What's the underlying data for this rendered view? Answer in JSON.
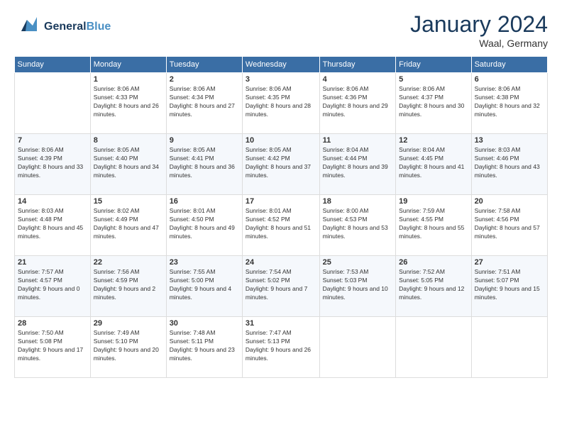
{
  "header": {
    "logo_general": "General",
    "logo_blue": "Blue",
    "month": "January 2024",
    "location": "Waal, Germany"
  },
  "days_of_week": [
    "Sunday",
    "Monday",
    "Tuesday",
    "Wednesday",
    "Thursday",
    "Friday",
    "Saturday"
  ],
  "weeks": [
    [
      {
        "day": "",
        "sunrise": "",
        "sunset": "",
        "daylight": ""
      },
      {
        "day": "1",
        "sunrise": "Sunrise: 8:06 AM",
        "sunset": "Sunset: 4:33 PM",
        "daylight": "Daylight: 8 hours and 26 minutes."
      },
      {
        "day": "2",
        "sunrise": "Sunrise: 8:06 AM",
        "sunset": "Sunset: 4:34 PM",
        "daylight": "Daylight: 8 hours and 27 minutes."
      },
      {
        "day": "3",
        "sunrise": "Sunrise: 8:06 AM",
        "sunset": "Sunset: 4:35 PM",
        "daylight": "Daylight: 8 hours and 28 minutes."
      },
      {
        "day": "4",
        "sunrise": "Sunrise: 8:06 AM",
        "sunset": "Sunset: 4:36 PM",
        "daylight": "Daylight: 8 hours and 29 minutes."
      },
      {
        "day": "5",
        "sunrise": "Sunrise: 8:06 AM",
        "sunset": "Sunset: 4:37 PM",
        "daylight": "Daylight: 8 hours and 30 minutes."
      },
      {
        "day": "6",
        "sunrise": "Sunrise: 8:06 AM",
        "sunset": "Sunset: 4:38 PM",
        "daylight": "Daylight: 8 hours and 32 minutes."
      }
    ],
    [
      {
        "day": "7",
        "sunrise": "Sunrise: 8:06 AM",
        "sunset": "Sunset: 4:39 PM",
        "daylight": "Daylight: 8 hours and 33 minutes."
      },
      {
        "day": "8",
        "sunrise": "Sunrise: 8:05 AM",
        "sunset": "Sunset: 4:40 PM",
        "daylight": "Daylight: 8 hours and 34 minutes."
      },
      {
        "day": "9",
        "sunrise": "Sunrise: 8:05 AM",
        "sunset": "Sunset: 4:41 PM",
        "daylight": "Daylight: 8 hours and 36 minutes."
      },
      {
        "day": "10",
        "sunrise": "Sunrise: 8:05 AM",
        "sunset": "Sunset: 4:42 PM",
        "daylight": "Daylight: 8 hours and 37 minutes."
      },
      {
        "day": "11",
        "sunrise": "Sunrise: 8:04 AM",
        "sunset": "Sunset: 4:44 PM",
        "daylight": "Daylight: 8 hours and 39 minutes."
      },
      {
        "day": "12",
        "sunrise": "Sunrise: 8:04 AM",
        "sunset": "Sunset: 4:45 PM",
        "daylight": "Daylight: 8 hours and 41 minutes."
      },
      {
        "day": "13",
        "sunrise": "Sunrise: 8:03 AM",
        "sunset": "Sunset: 4:46 PM",
        "daylight": "Daylight: 8 hours and 43 minutes."
      }
    ],
    [
      {
        "day": "14",
        "sunrise": "Sunrise: 8:03 AM",
        "sunset": "Sunset: 4:48 PM",
        "daylight": "Daylight: 8 hours and 45 minutes."
      },
      {
        "day": "15",
        "sunrise": "Sunrise: 8:02 AM",
        "sunset": "Sunset: 4:49 PM",
        "daylight": "Daylight: 8 hours and 47 minutes."
      },
      {
        "day": "16",
        "sunrise": "Sunrise: 8:01 AM",
        "sunset": "Sunset: 4:50 PM",
        "daylight": "Daylight: 8 hours and 49 minutes."
      },
      {
        "day": "17",
        "sunrise": "Sunrise: 8:01 AM",
        "sunset": "Sunset: 4:52 PM",
        "daylight": "Daylight: 8 hours and 51 minutes."
      },
      {
        "day": "18",
        "sunrise": "Sunrise: 8:00 AM",
        "sunset": "Sunset: 4:53 PM",
        "daylight": "Daylight: 8 hours and 53 minutes."
      },
      {
        "day": "19",
        "sunrise": "Sunrise: 7:59 AM",
        "sunset": "Sunset: 4:55 PM",
        "daylight": "Daylight: 8 hours and 55 minutes."
      },
      {
        "day": "20",
        "sunrise": "Sunrise: 7:58 AM",
        "sunset": "Sunset: 4:56 PM",
        "daylight": "Daylight: 8 hours and 57 minutes."
      }
    ],
    [
      {
        "day": "21",
        "sunrise": "Sunrise: 7:57 AM",
        "sunset": "Sunset: 4:57 PM",
        "daylight": "Daylight: 9 hours and 0 minutes."
      },
      {
        "day": "22",
        "sunrise": "Sunrise: 7:56 AM",
        "sunset": "Sunset: 4:59 PM",
        "daylight": "Daylight: 9 hours and 2 minutes."
      },
      {
        "day": "23",
        "sunrise": "Sunrise: 7:55 AM",
        "sunset": "Sunset: 5:00 PM",
        "daylight": "Daylight: 9 hours and 4 minutes."
      },
      {
        "day": "24",
        "sunrise": "Sunrise: 7:54 AM",
        "sunset": "Sunset: 5:02 PM",
        "daylight": "Daylight: 9 hours and 7 minutes."
      },
      {
        "day": "25",
        "sunrise": "Sunrise: 7:53 AM",
        "sunset": "Sunset: 5:03 PM",
        "daylight": "Daylight: 9 hours and 10 minutes."
      },
      {
        "day": "26",
        "sunrise": "Sunrise: 7:52 AM",
        "sunset": "Sunset: 5:05 PM",
        "daylight": "Daylight: 9 hours and 12 minutes."
      },
      {
        "day": "27",
        "sunrise": "Sunrise: 7:51 AM",
        "sunset": "Sunset: 5:07 PM",
        "daylight": "Daylight: 9 hours and 15 minutes."
      }
    ],
    [
      {
        "day": "28",
        "sunrise": "Sunrise: 7:50 AM",
        "sunset": "Sunset: 5:08 PM",
        "daylight": "Daylight: 9 hours and 17 minutes."
      },
      {
        "day": "29",
        "sunrise": "Sunrise: 7:49 AM",
        "sunset": "Sunset: 5:10 PM",
        "daylight": "Daylight: 9 hours and 20 minutes."
      },
      {
        "day": "30",
        "sunrise": "Sunrise: 7:48 AM",
        "sunset": "Sunset: 5:11 PM",
        "daylight": "Daylight: 9 hours and 23 minutes."
      },
      {
        "day": "31",
        "sunrise": "Sunrise: 7:47 AM",
        "sunset": "Sunset: 5:13 PM",
        "daylight": "Daylight: 9 hours and 26 minutes."
      },
      {
        "day": "",
        "sunrise": "",
        "sunset": "",
        "daylight": ""
      },
      {
        "day": "",
        "sunrise": "",
        "sunset": "",
        "daylight": ""
      },
      {
        "day": "",
        "sunrise": "",
        "sunset": "",
        "daylight": ""
      }
    ]
  ]
}
